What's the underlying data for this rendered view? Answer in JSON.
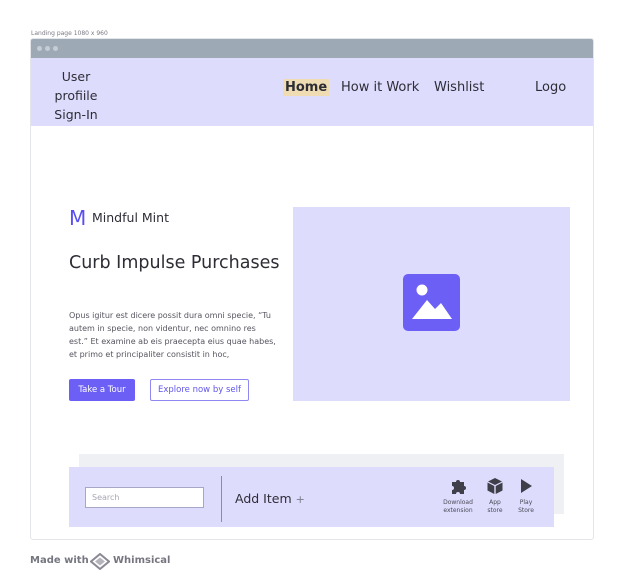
{
  "frame_label": "Landing page 1080 x 960",
  "nav": {
    "user_menu": [
      "User",
      "profiile",
      "Sign-In"
    ],
    "links": {
      "home": "Home",
      "how": "How it Work",
      "wishlist": "Wishlist",
      "logo": "Logo"
    },
    "active": "Home"
  },
  "brand": {
    "mark": "M",
    "name": "Mindful Mint"
  },
  "hero": {
    "title": "Curb Impulse Purchases",
    "body": "Opus igitur est dicere possit dura omni specie, “Tu autem in specie, non videntur, nec omnino res est.” Et examine ab eis praecepta eius quae habes, et primo et principaliter consistit in hoc,",
    "primary_button": "Take a Tour",
    "secondary_button": "Explore now by self",
    "image_icon": "image-placeholder-icon"
  },
  "footer_bar": {
    "search_placeholder": "Search",
    "add_item": "Add Item",
    "add_symbol": "+",
    "actions": [
      {
        "icon": "puzzle-icon",
        "label_line1": "Download",
        "label_line2": "extension"
      },
      {
        "icon": "box-icon",
        "label_line1": "App",
        "label_line2": "store"
      },
      {
        "icon": "play-icon",
        "label_line1": "Play",
        "label_line2": "Store"
      }
    ]
  },
  "watermark": {
    "prefix": "Made with",
    "brand": "Whimsical"
  },
  "colors": {
    "accent": "#6c5ff5",
    "panel": "#dedcfd",
    "highlight": "#efdcb2",
    "browser_bar": "#9ea9b6"
  }
}
